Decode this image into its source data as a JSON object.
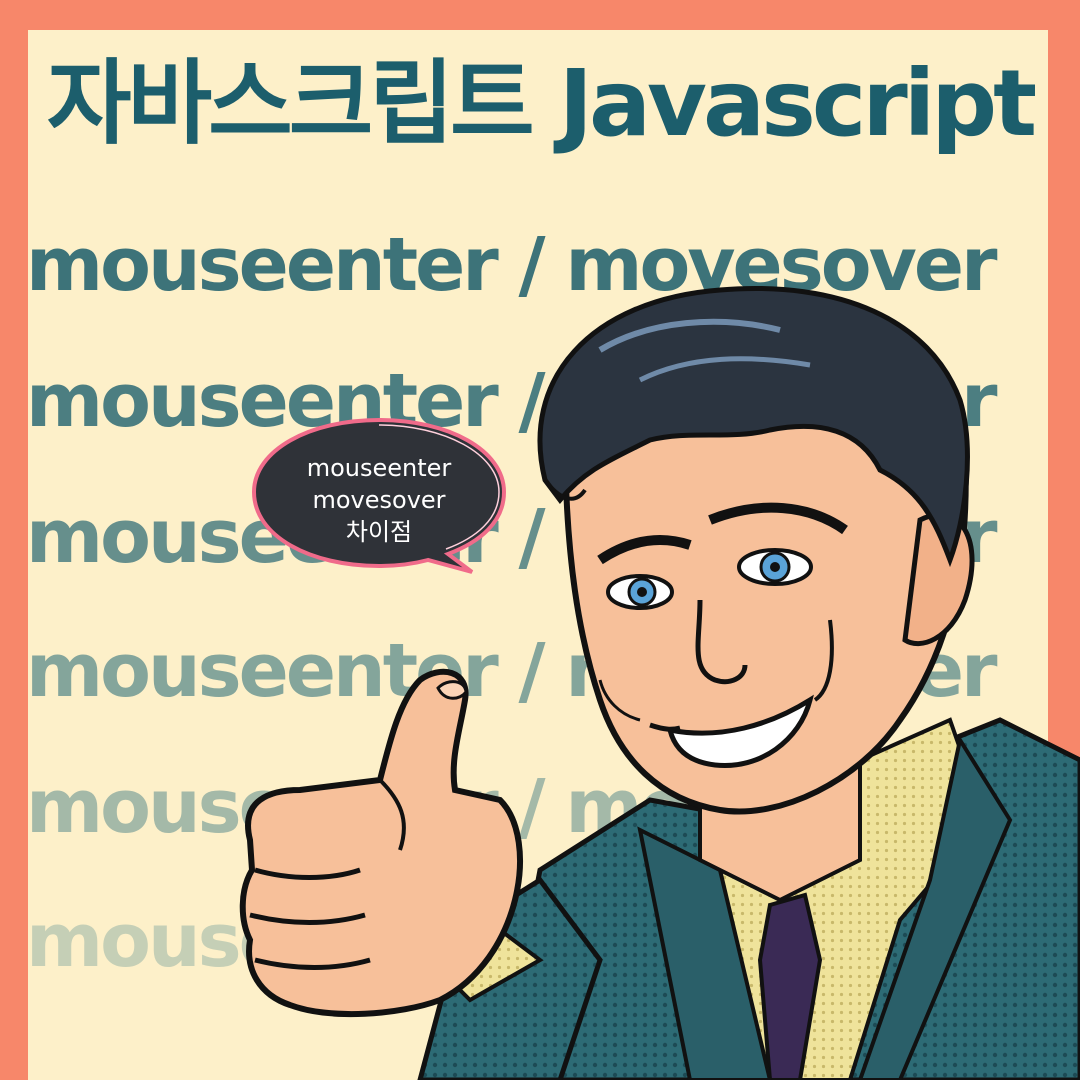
{
  "title": "자바스크립트 Javascript",
  "background_lines": [
    {
      "text": "mouseenter / movesover",
      "color": "#3d7379"
    },
    {
      "text": "mouseenter / movesover",
      "color": "#4c7e81"
    },
    {
      "text": "mouseenter / movesover",
      "color": "#668f8c"
    },
    {
      "text": "mouseenter / movesover",
      "color": "#84a59b"
    },
    {
      "text": "mouseenter / movesover",
      "color": "#a4b9a8"
    },
    {
      "text": "mouseenter / movesover",
      "color": "#c5cfb6"
    }
  ],
  "speech_bubble": {
    "line1": "mouseenter",
    "line2": "movesover",
    "line3": "차이점",
    "fill": "#2f3238",
    "glow": "#f06b8a"
  },
  "colors": {
    "frame": "#f7876a",
    "panel": "#fdf0c9",
    "title": "#1c5e6c",
    "suit": "#2d6b75",
    "skin": "#f7c09a",
    "hair": "#2b3440"
  }
}
